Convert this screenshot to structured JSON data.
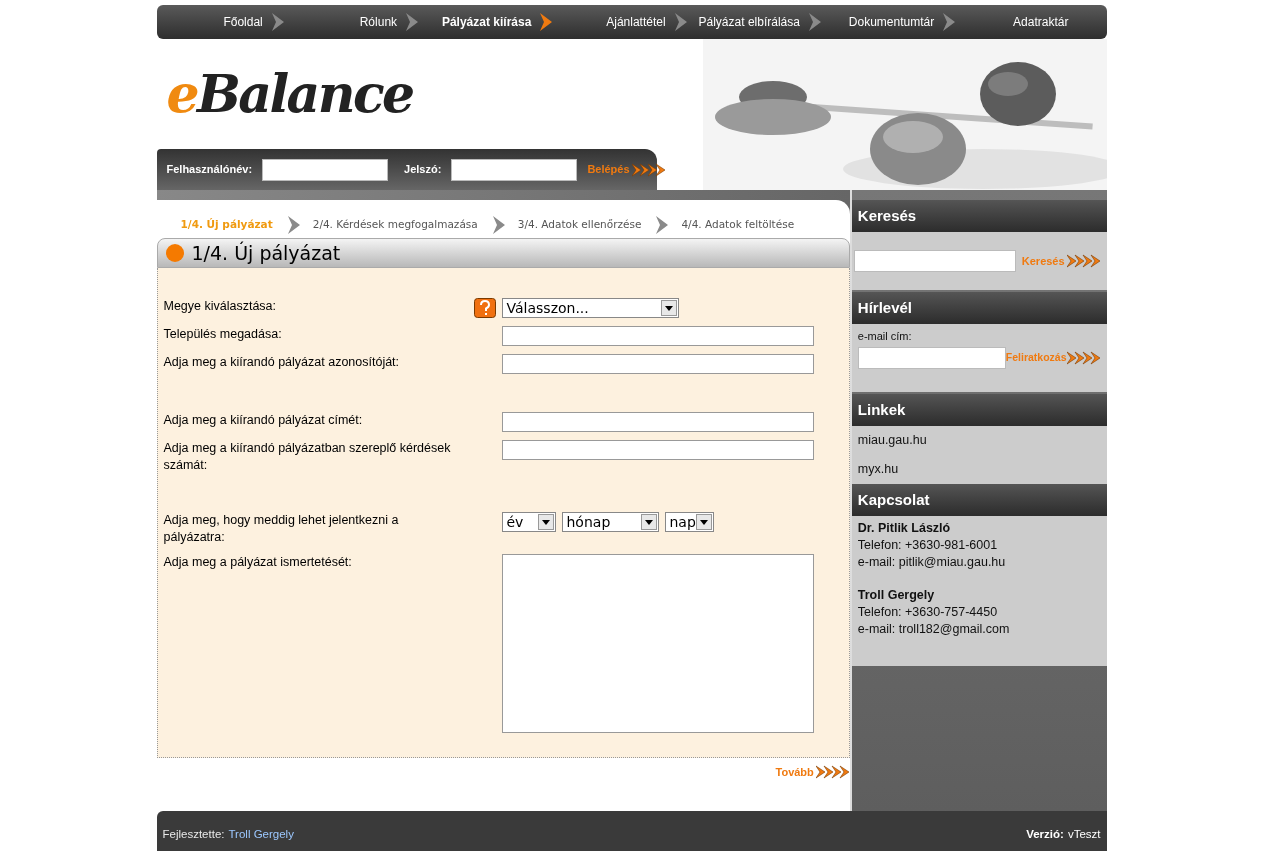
{
  "nav": [
    {
      "label": "Főoldal",
      "selected": false
    },
    {
      "label": "Rólunk",
      "selected": false
    },
    {
      "label": "Pályázat kiírása",
      "selected": true
    },
    {
      "label": "Ajánlattétel",
      "selected": false
    },
    {
      "label": "Pályázat elbírálása",
      "selected": false
    },
    {
      "label": "Dokumentumtár",
      "selected": false
    },
    {
      "label": "Adatraktár",
      "selected": false
    }
  ],
  "logo": {
    "prefix": "e",
    "rest": "Balance"
  },
  "login": {
    "username_label": "Felhasználónév:",
    "password_label": "Jelszó:",
    "button": "Belépés"
  },
  "steps": [
    {
      "label": "1/4. Új pályázat",
      "selected": true
    },
    {
      "label": "2/4. Kérdések megfogalmazása",
      "selected": false
    },
    {
      "label": "3/4. Adatok ellenőrzése",
      "selected": false
    },
    {
      "label": "4/4. Adatok feltöltése",
      "selected": false
    }
  ],
  "form": {
    "title": "1/4. Új pályázat",
    "field_groups": [
      [
        {
          "kind": "select",
          "label": "Megye kiválasztása:",
          "help": true,
          "value": "Válasszon..."
        },
        {
          "kind": "text",
          "label": "Település megadása:"
        },
        {
          "kind": "text",
          "label": "Adja meg a kiírandó pályázat azonosítóját:"
        }
      ],
      [
        {
          "kind": "text",
          "label": "Adja meg a kiírandó pályázat címét:"
        },
        {
          "kind": "text",
          "label": "Adja meg a kiírandó pályázatban szereplő kérdések számát:"
        }
      ],
      [
        {
          "kind": "date",
          "label": "Adja meg, hogy meddig lehet jelentkezni a pályázatra:",
          "parts": [
            "év",
            "hónap",
            "nap"
          ]
        },
        {
          "kind": "textarea",
          "label": "Adja meg a pályázat ismertetését:"
        }
      ]
    ],
    "next": "Tovább"
  },
  "sidebar": {
    "search": {
      "title": "Keresés",
      "button": "Keresés"
    },
    "newsletter": {
      "title": "Hírlevél",
      "label": "e-mail cím:",
      "button": "Feliratkozás"
    },
    "links": {
      "title": "Linkek",
      "items": [
        "miau.gau.hu",
        "myx.hu"
      ]
    },
    "contact": {
      "title": "Kapcsolat",
      "people": [
        {
          "name": "Dr. Pitlik László",
          "phone": "Telefon: +3630-981-6001",
          "email": "e-mail: pitlik@miau.gau.hu"
        },
        {
          "name": "Troll Gergely",
          "phone": "Telefon: +3630-757-4450",
          "email": "e-mail: troll182@gmail.com"
        }
      ]
    }
  },
  "footer": {
    "developer_label": "Fejlesztette:",
    "developer": "Troll Gergely",
    "version_label": "Verzió:",
    "version": "vTeszt"
  }
}
